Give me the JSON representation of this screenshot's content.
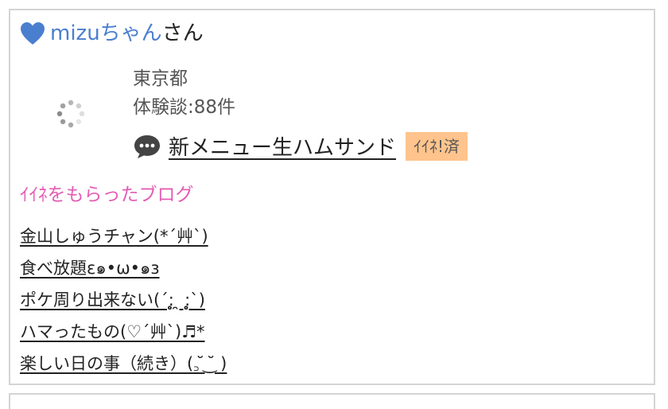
{
  "user": {
    "name": "mizuちゃん",
    "suffix": "さん",
    "heart_color": "#4a7fcf"
  },
  "profile": {
    "location": "東京都",
    "experience_count": "体験談:88件"
  },
  "latest_post": {
    "icon": "speech-bubble-icon",
    "title": "新メニュー生ハムサンド",
    "badge": "ｲｲﾈ!済"
  },
  "liked_blogs": {
    "heading": "ｲｲﾈをもらったブログ",
    "heading_color": "#e35db4",
    "items": [
      "金山しゅうチャン(*´艸`)",
      "食べ放題ε๑•ω•๑з",
      "ポケ周り出来ない(´:̥̥̥̥̥̥̥̥ ̯ :̥̥̥̥̥̥̥̥`)",
      "ハマったもの(♡´艸`)♬*",
      "楽しい日の事（続き）(꜆ ̆ ͜ ̆ )"
    ]
  }
}
